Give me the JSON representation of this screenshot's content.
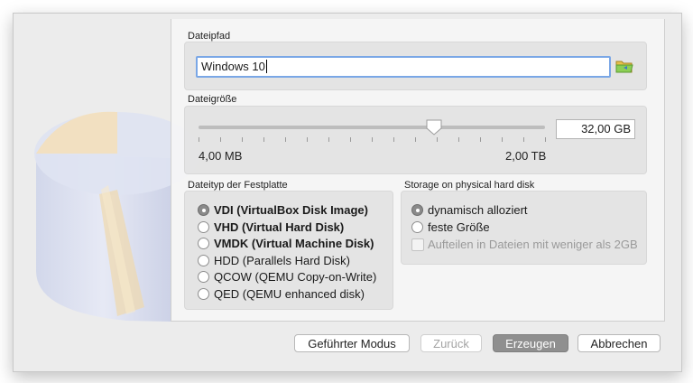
{
  "file_path": {
    "label": "Dateipfad",
    "value": "Windows 10",
    "browse_icon": "folder-icon"
  },
  "file_size": {
    "label": "Dateigröße",
    "value": "32,00 GB",
    "min_label": "4,00 MB",
    "max_label": "2,00 TB",
    "slider_fraction": 0.68
  },
  "file_type": {
    "label": "Dateityp der Festplatte",
    "options": [
      {
        "label": "VDI (VirtualBox Disk Image)",
        "selected": true,
        "bold": true
      },
      {
        "label": "VHD (Virtual Hard Disk)",
        "selected": false,
        "bold": true
      },
      {
        "label": "VMDK (Virtual Machine Disk)",
        "selected": false,
        "bold": true
      },
      {
        "label": "HDD (Parallels Hard Disk)",
        "selected": false,
        "bold": false
      },
      {
        "label": "QCOW (QEMU Copy-on-Write)",
        "selected": false,
        "bold": false
      },
      {
        "label": "QED (QEMU enhanced disk)",
        "selected": false,
        "bold": false
      }
    ]
  },
  "storage": {
    "label": "Storage on physical hard disk",
    "options": [
      {
        "label": "dynamisch alloziert",
        "selected": true
      },
      {
        "label": "feste Größe",
        "selected": false
      }
    ],
    "split_checkbox": {
      "label": "Aufteilen in Dateien mit weniger als 2GB",
      "checked": false,
      "enabled": false
    }
  },
  "buttons": {
    "guided": "Geführter Modus",
    "back": "Zurück",
    "create": "Erzeugen",
    "cancel": "Abbrechen"
  }
}
